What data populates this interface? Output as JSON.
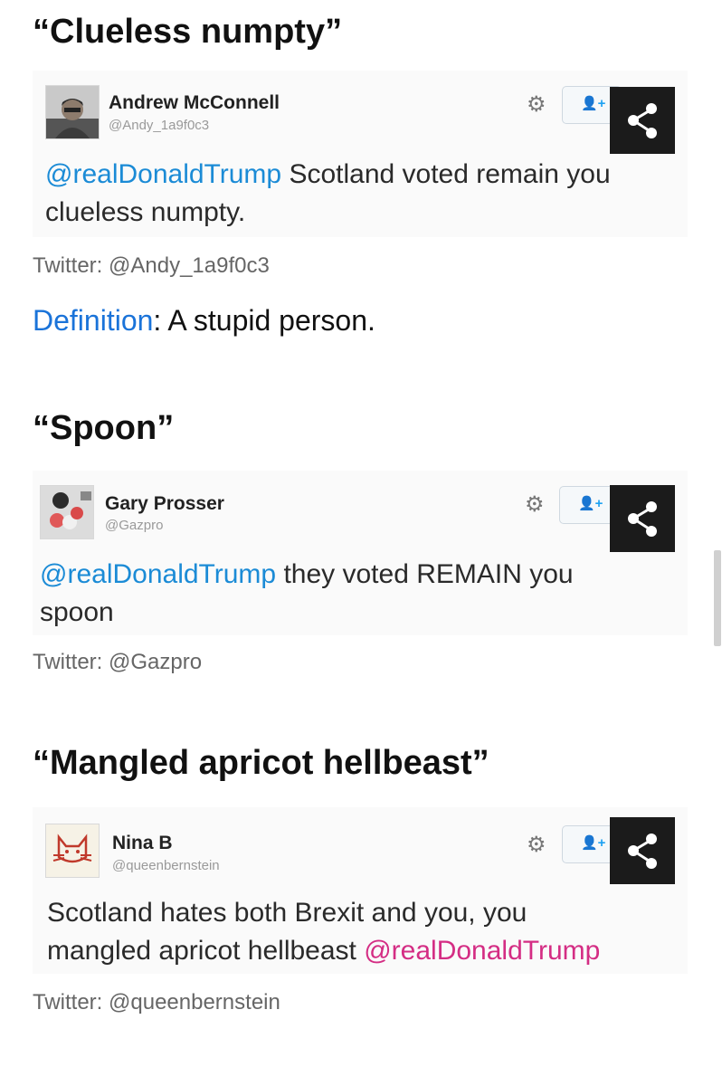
{
  "items": [
    {
      "heading": "“Clueless numpty”",
      "tweet": {
        "name": "Andrew McConnell",
        "handle": "@Andy_1a9f0c3",
        "mention": "@realDonaldTrump",
        "line1_rest": " Scotland voted remain you",
        "line2": "clueless numpty."
      },
      "caption": "Twitter: @Andy_1a9f0c3",
      "definition": {
        "link": "Definition",
        "text": ": A stupid person."
      }
    },
    {
      "heading": "“Spoon”",
      "tweet": {
        "name": "Gary Prosser",
        "handle": "@Gazpro",
        "mention": "@realDonaldTrump",
        "line1_rest": " they voted REMAIN you",
        "line2": "spoon"
      },
      "caption": "Twitter: @Gazpro"
    },
    {
      "heading": "“Mangled apricot hellbeast”",
      "tweet": {
        "name": "Nina B",
        "handle": "@queenbernstein",
        "line1": "Scotland hates both Brexit and you, you",
        "line2_start": "mangled apricot hellbeast ",
        "mention": "@realDonaldTrump"
      },
      "caption": "Twitter: @queenbernstein"
    }
  ],
  "icons": {
    "gear": "gear-icon",
    "follow": "follow-user-icon",
    "share": "share-icon"
  },
  "colors": {
    "mention_blue": "#1b8bd6",
    "mention_pink": "#d42d84",
    "definition_link": "#1a73d9",
    "share_button_bg": "#1b1b1b"
  }
}
